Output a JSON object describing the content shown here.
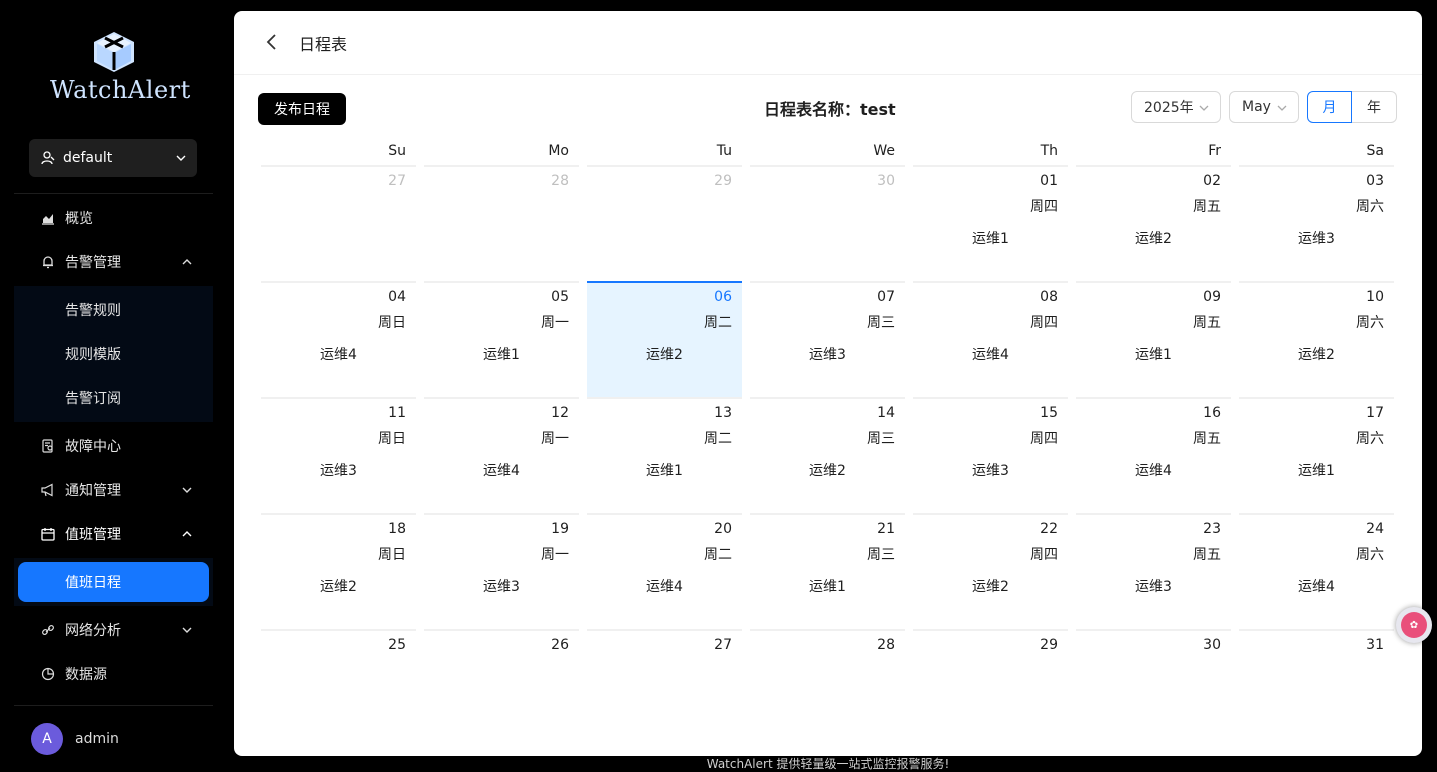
{
  "app": {
    "logo_text": "WatchAlert",
    "footer": "WatchAlert 提供轻量级一站式监控报警服务!"
  },
  "tenant": {
    "label": "default"
  },
  "nav": {
    "overview": "概览",
    "alert_mgmt": "告警管理",
    "alert_sub": [
      "告警规则",
      "规则模版",
      "告警订阅"
    ],
    "fault_center": "故障中心",
    "notify_mgmt": "通知管理",
    "duty_mgmt": "值班管理",
    "duty_sub": [
      "值班日程"
    ],
    "network": "网络分析",
    "datasource": "数据源"
  },
  "user": {
    "avatar_letter": "A",
    "name": "admin"
  },
  "page": {
    "title": "日程表",
    "publish_btn": "发布日程",
    "calendar_name": "日程表名称：test"
  },
  "controls": {
    "year": "2025年",
    "month": "May",
    "view_month": "月",
    "view_year": "年",
    "active_view": "月"
  },
  "colors": {
    "accent": "#1677ff",
    "today_bg": "#e6f4ff",
    "sidebar_bg": "#000000"
  },
  "weekdays": [
    "Su",
    "Mo",
    "Tu",
    "We",
    "Th",
    "Fr",
    "Sa"
  ],
  "calendar": {
    "weeks": [
      [
        {
          "d": "27",
          "other": true
        },
        {
          "d": "28",
          "other": true
        },
        {
          "d": "29",
          "other": true
        },
        {
          "d": "30",
          "other": true
        },
        {
          "d": "01",
          "wk": "周四",
          "duty": "运维1"
        },
        {
          "d": "02",
          "wk": "周五",
          "duty": "运维2"
        },
        {
          "d": "03",
          "wk": "周六",
          "duty": "运维3"
        }
      ],
      [
        {
          "d": "04",
          "wk": "周日",
          "duty": "运维4"
        },
        {
          "d": "05",
          "wk": "周一",
          "duty": "运维1"
        },
        {
          "d": "06",
          "wk": "周二",
          "duty": "运维2",
          "today": true
        },
        {
          "d": "07",
          "wk": "周三",
          "duty": "运维3"
        },
        {
          "d": "08",
          "wk": "周四",
          "duty": "运维4"
        },
        {
          "d": "09",
          "wk": "周五",
          "duty": "运维1"
        },
        {
          "d": "10",
          "wk": "周六",
          "duty": "运维2"
        }
      ],
      [
        {
          "d": "11",
          "wk": "周日",
          "duty": "运维3"
        },
        {
          "d": "12",
          "wk": "周一",
          "duty": "运维4"
        },
        {
          "d": "13",
          "wk": "周二",
          "duty": "运维1"
        },
        {
          "d": "14",
          "wk": "周三",
          "duty": "运维2"
        },
        {
          "d": "15",
          "wk": "周四",
          "duty": "运维3"
        },
        {
          "d": "16",
          "wk": "周五",
          "duty": "运维4"
        },
        {
          "d": "17",
          "wk": "周六",
          "duty": "运维1"
        }
      ],
      [
        {
          "d": "18",
          "wk": "周日",
          "duty": "运维2"
        },
        {
          "d": "19",
          "wk": "周一",
          "duty": "运维3"
        },
        {
          "d": "20",
          "wk": "周二",
          "duty": "运维4"
        },
        {
          "d": "21",
          "wk": "周三",
          "duty": "运维1"
        },
        {
          "d": "22",
          "wk": "周四",
          "duty": "运维2"
        },
        {
          "d": "23",
          "wk": "周五",
          "duty": "运维3"
        },
        {
          "d": "24",
          "wk": "周六",
          "duty": "运维4"
        }
      ],
      [
        {
          "d": "25"
        },
        {
          "d": "26"
        },
        {
          "d": "27"
        },
        {
          "d": "28"
        },
        {
          "d": "29"
        },
        {
          "d": "30"
        },
        {
          "d": "31"
        }
      ]
    ]
  }
}
